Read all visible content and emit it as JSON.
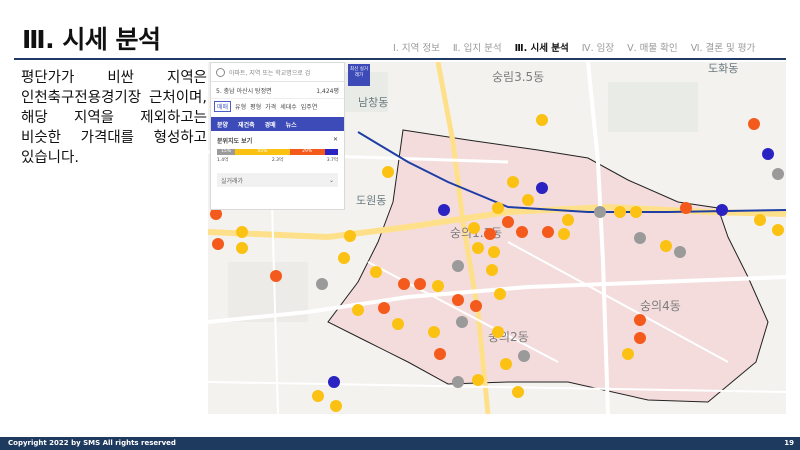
{
  "slide": {
    "title": "Ⅲ. 시세 분석",
    "nav": [
      "Ⅰ. 지역 정보",
      "Ⅱ. 입지 분석",
      "Ⅲ. 시세 분석",
      "Ⅳ. 임장",
      "Ⅴ. 매물 확인",
      "Ⅵ. 결론 및 평가"
    ],
    "active_nav_index": 2,
    "body_text": "평단가가 비싼 지역은 인천축구전용경기장 근처이며, 해당 지역을 제외하고는 비슷한 가격대를 형성하고 있습니다.",
    "footer_copyright": "Copyright 2022 by SMS All rights reserved",
    "page_number": "19"
  },
  "map_panel": {
    "search_placeholder": "아파트, 지역 또는 학교명으로 검",
    "location": "5. 충남 아산시 탕정면",
    "location_value": "1,424평",
    "filters": [
      "매매",
      "유형",
      "평형",
      "가격",
      "세대수",
      "입주연"
    ],
    "tabs": [
      "분양",
      "재건축",
      "경매",
      "뉴스"
    ],
    "dist_title": "분위지도 보기",
    "dist_segments": [
      {
        "label": "15%",
        "color": "#9a9a9a",
        "pct": 15
      },
      {
        "label": "45%",
        "color": "#fbc213",
        "pct": 45
      },
      {
        "label": "29%",
        "color": "#f35a1c",
        "pct": 29
      },
      {
        "label": "",
        "color": "#2b22c2",
        "pct": 11
      }
    ],
    "dist_marks": [
      "1.4억",
      "2.3억",
      "3.7억"
    ],
    "trade_label": "실거래가",
    "badge_text": "최신 실거래가"
  },
  "map_labels": [
    "숭림3.5동",
    "도원동",
    "숭의1.3동",
    "숭의2동",
    "숭의4동",
    "남창동",
    "도화동"
  ],
  "legend_colors": {
    "low": "#9a9a9a",
    "mid": "#fbc213",
    "high": "#f35a1c",
    "top": "#2b22c2"
  }
}
